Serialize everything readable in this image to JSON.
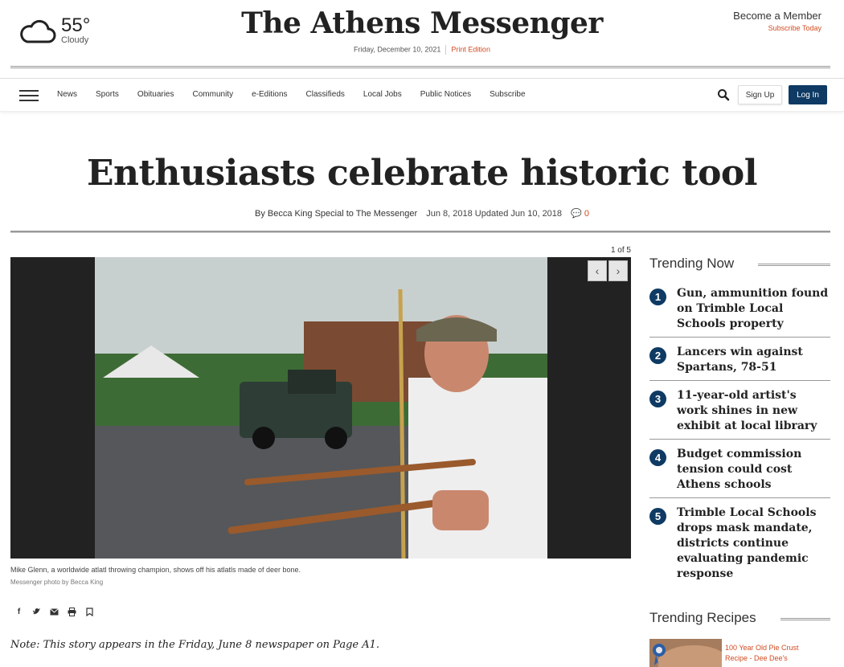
{
  "weather": {
    "temp": "55°",
    "condition": "Cloudy"
  },
  "site": {
    "name": "The Athens Messenger",
    "date": "Friday, December 10, 2021",
    "print_edition": "Print Edition"
  },
  "member": {
    "become": "Become a Member",
    "subscribe": "Subscribe Today"
  },
  "nav": {
    "items": [
      "News",
      "Sports",
      "Obituaries",
      "Community",
      "e-Editions",
      "Classifieds",
      "Local Jobs",
      "Public Notices",
      "Subscribe"
    ],
    "signup": "Sign Up",
    "login": "Log In"
  },
  "article": {
    "headline": "Enthusiasts celebrate historic tool",
    "byline": "By Becca King Special to The Messenger",
    "dates": "Jun 8, 2018 Updated Jun 10, 2018",
    "comments": "0",
    "photo_counter": "1 of 5",
    "caption": "Mike Glenn, a worldwide atlatl throwing champion, shows off his atlatls made of deer bone.",
    "credit": "Messenger photo by Becca King",
    "note": "Note: This story appears in the Friday, June 8 newspaper on Page A1."
  },
  "trending": {
    "heading": "Trending Now",
    "items": [
      {
        "num": "1",
        "title": "Gun, ammunition found on Trimble Local Schools property"
      },
      {
        "num": "2",
        "title": "Lancers win against Spartans, 78-51"
      },
      {
        "num": "3",
        "title": "11-year-old artist's work shines in new exhibit at local library"
      },
      {
        "num": "4",
        "title": "Budget commission tension could cost Athens schools"
      },
      {
        "num": "5",
        "title": "Trimble Local Schools drops mask mandate, districts continue evaluating pandemic response"
      }
    ]
  },
  "recipes": {
    "heading": "Trending Recipes",
    "items": [
      {
        "title": "100 Year Old Pie Crust Recipe - Dee Dee's"
      }
    ]
  },
  "colors": {
    "accent": "#d14b22",
    "navy": "#0e3a63"
  }
}
